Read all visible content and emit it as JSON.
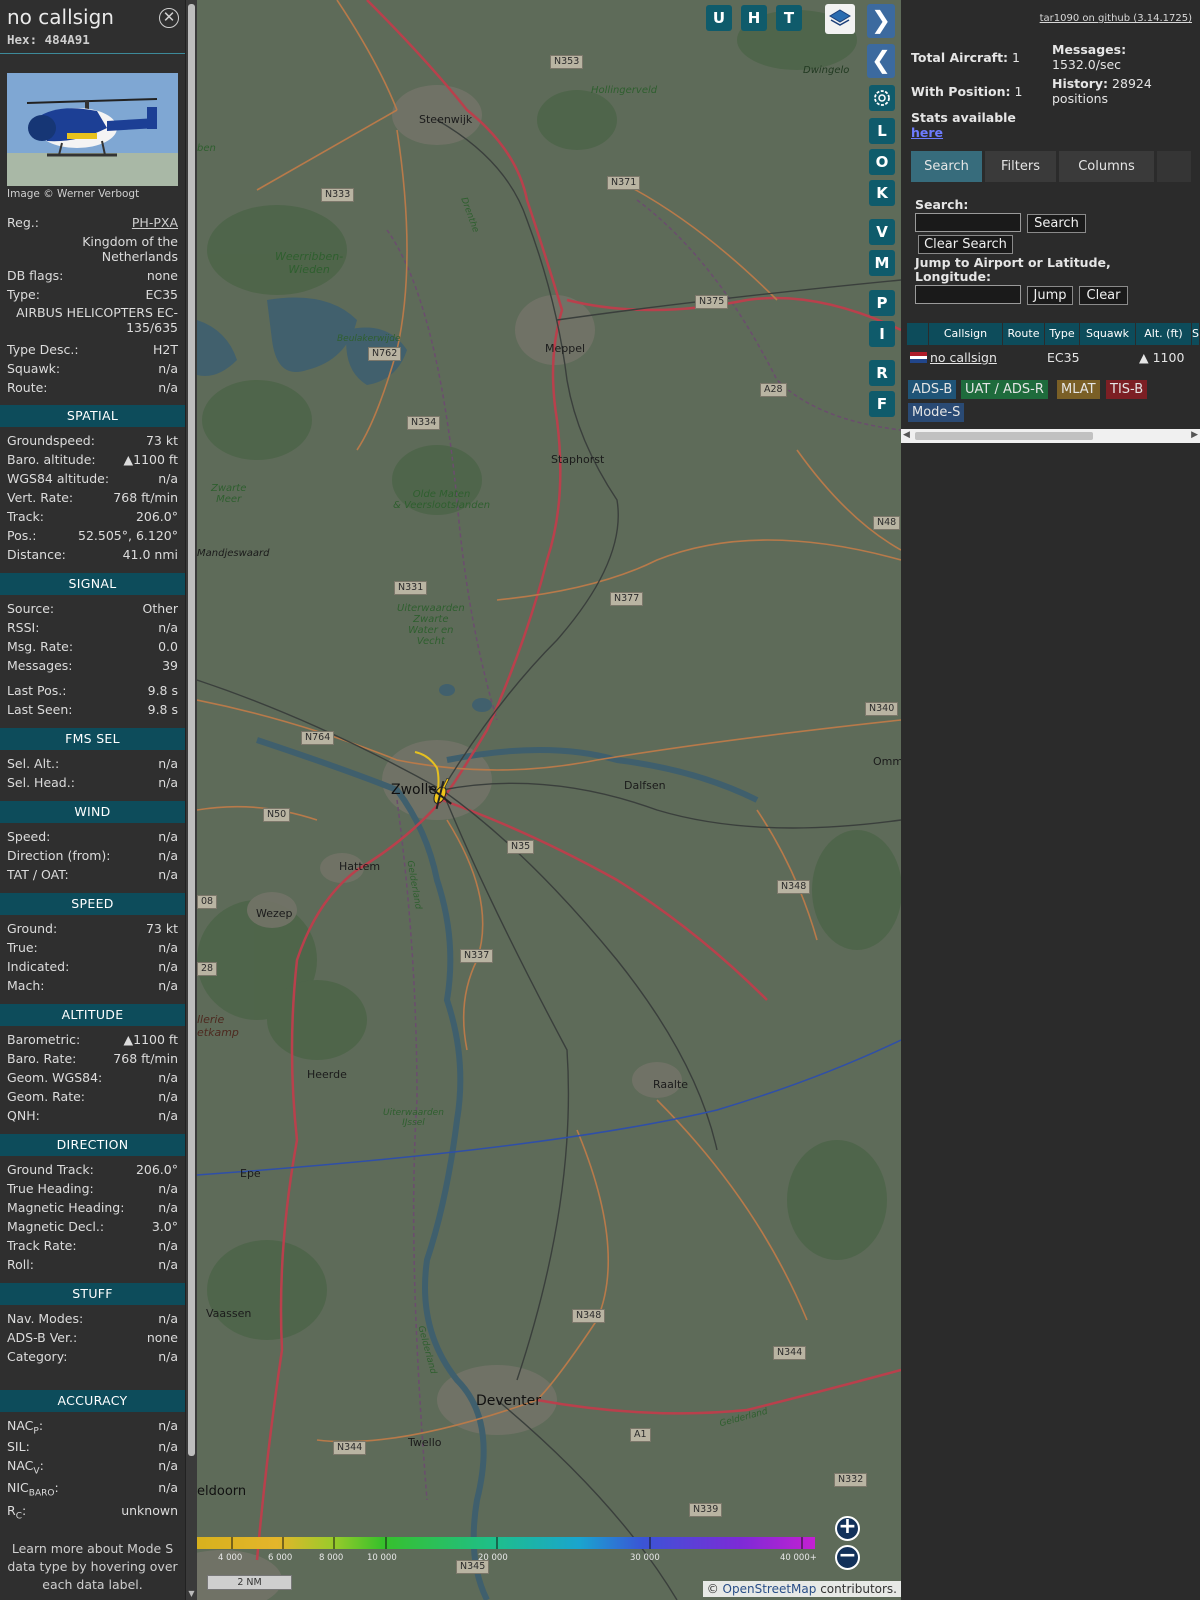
{
  "aircraft": {
    "callsign": "no callsign",
    "hex_label": "Hex:",
    "hex": "484A91",
    "close_icon": "close-icon",
    "photo_credit": "Image © Werner Verbogt"
  },
  "details": {
    "reg_label": "Reg.:",
    "reg": "PH-PXA",
    "country_line1": "Kingdom of the",
    "country_line2": "Netherlands",
    "dbflags_label": "DB flags:",
    "dbflags": "none",
    "type_label": "Type:",
    "type": "EC35",
    "typefull_line1": "AIRBUS HELICOPTERS EC-",
    "typefull_line2": "135/635",
    "typedesc_label": "Type Desc.:",
    "typedesc": "H2T",
    "squawk_label": "Squawk:",
    "squawk": "n/a",
    "route_label": "Route:",
    "route": "n/a"
  },
  "sections": {
    "spatial": {
      "title": "SPATIAL",
      "rows": [
        {
          "label": "Groundspeed:",
          "value": "73 kt"
        },
        {
          "label": "Baro. altitude:",
          "value": "▲1100 ft"
        },
        {
          "label": "WGS84 altitude:",
          "value": "n/a"
        },
        {
          "label": "Vert. Rate:",
          "value": "768 ft/min"
        },
        {
          "label": "Track:",
          "value": "206.0°"
        },
        {
          "label": "Pos.:",
          "value": "52.505°, 6.120°"
        },
        {
          "label": "Distance:",
          "value": "41.0 nmi"
        }
      ]
    },
    "signal": {
      "title": "SIGNAL",
      "rows": [
        {
          "label": "Source:",
          "value": "Other"
        },
        {
          "label": "RSSI:",
          "value": "n/a"
        },
        {
          "label": "Msg. Rate:",
          "value": "0.0"
        },
        {
          "label": "Messages:",
          "value": "39"
        },
        {
          "label": "Last Pos.:",
          "value": "9.8 s"
        },
        {
          "label": "Last Seen:",
          "value": "9.8 s"
        }
      ]
    },
    "fms": {
      "title": "FMS SEL",
      "rows": [
        {
          "label": "Sel. Alt.:",
          "value": "n/a"
        },
        {
          "label": "Sel. Head.:",
          "value": "n/a"
        }
      ]
    },
    "wind": {
      "title": "WIND",
      "rows": [
        {
          "label": "Speed:",
          "value": "n/a"
        },
        {
          "label": "Direction (from):",
          "value": "n/a"
        },
        {
          "label": "TAT / OAT:",
          "value": "n/a"
        }
      ]
    },
    "speed": {
      "title": "SPEED",
      "rows": [
        {
          "label": "Ground:",
          "value": "73 kt"
        },
        {
          "label": "True:",
          "value": "n/a"
        },
        {
          "label": "Indicated:",
          "value": "n/a"
        },
        {
          "label": "Mach:",
          "value": "n/a"
        }
      ]
    },
    "altitude": {
      "title": "ALTITUDE",
      "rows": [
        {
          "label": "Barometric:",
          "value": "▲1100 ft"
        },
        {
          "label": "Baro. Rate:",
          "value": "768 ft/min"
        },
        {
          "label": "Geom. WGS84:",
          "value": "n/a"
        },
        {
          "label": "Geom. Rate:",
          "value": "n/a"
        },
        {
          "label": "QNH:",
          "value": "n/a"
        }
      ]
    },
    "direction": {
      "title": "DIRECTION",
      "rows": [
        {
          "label": "Ground Track:",
          "value": "206.0°"
        },
        {
          "label": "True Heading:",
          "value": "n/a"
        },
        {
          "label": "Magnetic Heading:",
          "value": "n/a"
        },
        {
          "label": "Magnetic Decl.:",
          "value": "3.0°"
        },
        {
          "label": "Track Rate:",
          "value": "n/a"
        },
        {
          "label": "Roll:",
          "value": "n/a"
        }
      ]
    },
    "stuff": {
      "title": "STUFF",
      "rows": [
        {
          "label": "Nav. Modes:",
          "value": "n/a"
        },
        {
          "label": "ADS-B Ver.:",
          "value": "none"
        },
        {
          "label": "Category:",
          "value": "n/a"
        }
      ]
    },
    "accuracy": {
      "title": "ACCURACY",
      "rows": [
        {
          "label": "NAC",
          "sub": "P",
          "value": "n/a"
        },
        {
          "label": "SIL:",
          "sub": "",
          "value": "n/a"
        },
        {
          "label": "NAC",
          "sub": "V",
          "value": "n/a"
        },
        {
          "label": "NIC",
          "sub": "BARO",
          "value": "n/a"
        },
        {
          "label": "R",
          "sub": "C",
          "value": "unknown"
        }
      ]
    }
  },
  "note": {
    "line1": "Learn more about Mode S",
    "line2": "data type by hovering over",
    "line3": "each data label."
  },
  "map": {
    "toolbar_top": [
      "U",
      "H",
      "T"
    ],
    "side_buttons": [
      "L",
      "O",
      "K",
      "V",
      "M",
      "P",
      "I",
      "R",
      "F"
    ],
    "places": {
      "steenwijk": "Steenwijk",
      "dwingelo": "Dwingelo",
      "hollingerveld": "Hollingerveld",
      "weerribben1": "Weerribben-",
      "weerribben2": "Wieden",
      "beulakerwijde": "Beulakerwijde",
      "meppel": "Meppel",
      "staphorst": "Staphorst",
      "zwarte1": "Zwarte",
      "zwarte2": "Meer",
      "oldematen1": "Olde Maten",
      "oldematen2": "& Veerslootslanden",
      "mandjeswaard": "Mandjeswaard",
      "uiterwaarden1": "Uiterwaarden",
      "uiterwaarden2": "Zwarte",
      "uiterwaarden3": "Water en",
      "uiterwaarden4": "Vecht",
      "zwolle": "Zwolle",
      "dalfsen": "Dalfsen",
      "hattem": "Hattem",
      "wezep": "Wezep",
      "heerde": "Heerde",
      "raalte": "Raalte",
      "epe": "Epe",
      "vaassen": "Vaassen",
      "deventer": "Deventer",
      "twello": "Twello",
      "apeldoorn": "eldoorn",
      "omm": "Omm",
      "drenthe": "Drenthe",
      "gelderland1": "Gelderland",
      "gelderland2": "Gelderland",
      "gelderland3": "Gelderland",
      "uitijssel1": "Uiterwaarden",
      "uitijssel2": "IJssel",
      "artillerie1": "llerie",
      "artillerie2": "etkamp",
      "ben": "ben"
    },
    "roads": {
      "n353": "N353",
      "n333": "N333",
      "n371": "N371",
      "n375": "N375",
      "n762": "N762",
      "a28": "A28",
      "n334": "N334",
      "n48": "N48",
      "n331": "N331",
      "n377": "N377",
      "n340": "N340",
      "n764": "N764",
      "n50": "N50",
      "n35": "N35",
      "n348a": "N348",
      "n337": "N337",
      "n348b": "N348",
      "n344a": "N344",
      "n344b": "N344",
      "a1": "A1",
      "n332": "N332",
      "n339": "N339",
      "n345": "N345",
      "n308": "08",
      "n328": "28"
    },
    "legend_labels": [
      "4 000",
      "6 000",
      "8 000",
      "10 000",
      "20 000",
      "30 000",
      "40 000+"
    ],
    "scale": "2 NM",
    "attribution_prefix": "© ",
    "attribution_link": "OpenStreetMap",
    "attribution_suffix": " contributors."
  },
  "panel": {
    "github_link": "tar1090 on github (3.14.1725)",
    "total_label": "Total Aircraft:",
    "total": "1",
    "messages_label": "Messages:",
    "messages": "1532.0/sec",
    "withpos_label": "With Position:",
    "withpos": "1",
    "history_label": "History:",
    "history_value": "28924",
    "history_unit": "positions",
    "stats_text": "Stats available",
    "stats_link": "here",
    "tabs": [
      "Search",
      "Filters",
      "Columns"
    ],
    "search_label": "Search:",
    "search_button": "Search",
    "clear_search_button": "Clear Search",
    "jump_label1": "Jump to Airport or Latitude,",
    "jump_label2": "Longitude:",
    "jump_button": "Jump",
    "clear_button": "Clear",
    "columns": [
      "Callsign",
      "Route",
      "Type",
      "Squawk",
      "Alt. (ft)",
      "S"
    ],
    "row": {
      "callsign": "no callsign",
      "route": "",
      "type": "EC35",
      "squawk": "",
      "alt": "▲ 1100"
    },
    "source_tags": [
      "ADS-B",
      "UAT / ADS-R",
      "MLAT",
      "TIS-B",
      "Mode-S"
    ],
    "colors": {
      "adsb": "#1f5477",
      "uat": "#1e6b3c",
      "mlat": "#7a5f26",
      "tisb": "#7c1f24",
      "modes": "#2a4a74"
    }
  }
}
